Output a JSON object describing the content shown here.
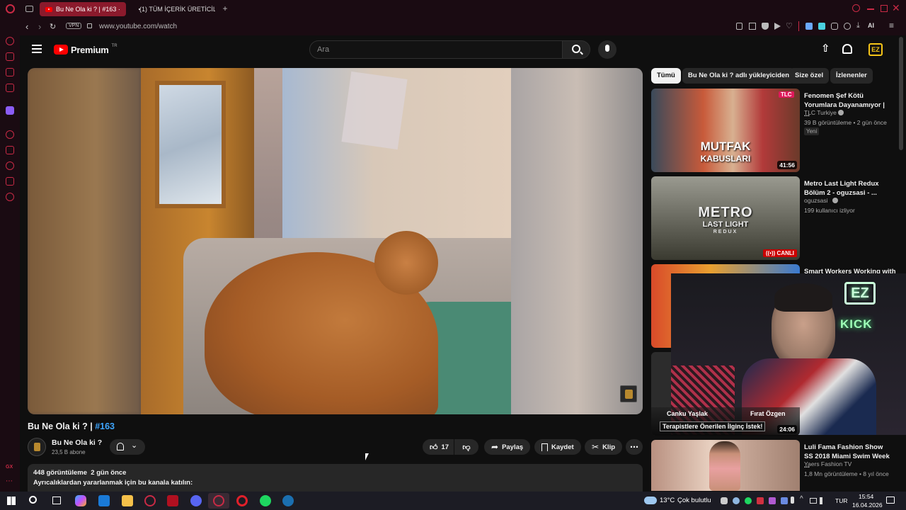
{
  "browser": {
    "tabs": [
      {
        "label": "Bu Ne Ola ki ? | #163 ·"
      },
      {
        "label": "(1) TÜM İÇERİK ÜRETİCİLE"
      }
    ],
    "vpn_badge": "VPN",
    "url": "www.youtube.com/watch",
    "ai_label": "AI"
  },
  "youtube": {
    "logo_text": "Premium",
    "logo_region": "TR",
    "search_placeholder": "Ara"
  },
  "video": {
    "title_main": "Bu Ne Ola ki ? |",
    "title_tag": "#163",
    "channel_name": "Bu Ne Ola ki ?",
    "subscribers": "23,5 B abone",
    "likes": "17",
    "share_label": "Paylaş",
    "save_label": "Kaydet",
    "clip_label": "Klip",
    "views_line": "448 görüntüleme  2 gün önce",
    "description_line": "Ayrıcalıklardan yararlanmak için bu kanala katılın:"
  },
  "chips": [
    {
      "label": "Tümü"
    },
    {
      "label": "Bu Ne Ola ki ? adlı yükleyiciden"
    },
    {
      "label": "Size özel"
    },
    {
      "label": "İzlenenler"
    }
  ],
  "recommendations": [
    {
      "title": "Fenomen Şef Kötü Yorumlara Dayanamıyor | ...",
      "channel": "TLC Turkiye",
      "meta": "39 B görüntüleme • 2 gün önce",
      "badge": "Yeni",
      "duration": "41:56",
      "thumb_text_1": "MUTFAK",
      "thumb_text_2": "KABUSLARI",
      "thumb_logo": "TLC"
    },
    {
      "title": "Metro Last Light Redux Bölüm 2 - oguzsasi - ...",
      "channel": "oguzsasi",
      "meta": "199 kullanıcı izliyor",
      "live_badge": "CANLI",
      "thumb_text_1": "METRO",
      "thumb_text_2": "LAST LIGHT",
      "thumb_text_3": "REDUX"
    },
    {
      "title": "Smart Workers Working with",
      "duration": "24:06"
    },
    {
      "title": "Luli Fama Fashion Show SS 2018 Miami Swim Week ...",
      "channel": "Yaers Fashion TV",
      "meta": "1,8 Mn görüntüleme • 8 yıl önce"
    }
  ],
  "webcam_overlay": {
    "name_left": "Canku Yaşlak",
    "name_right": "Fırat Özgen",
    "caption": "Terapistlere Önerilen İlginç İstek!",
    "neon_logo": "EZ",
    "neon_text": "KICK"
  },
  "taskbar": {
    "weather_temp": "13°C",
    "weather_desc": "Çok bulutlu",
    "lang": "TUR",
    "time": "15:54",
    "date": "16.04.2026"
  },
  "colors": {
    "accent_red": "#ff0000",
    "opera_red": "#c92a45",
    "link_blue": "#3ea6ff"
  }
}
